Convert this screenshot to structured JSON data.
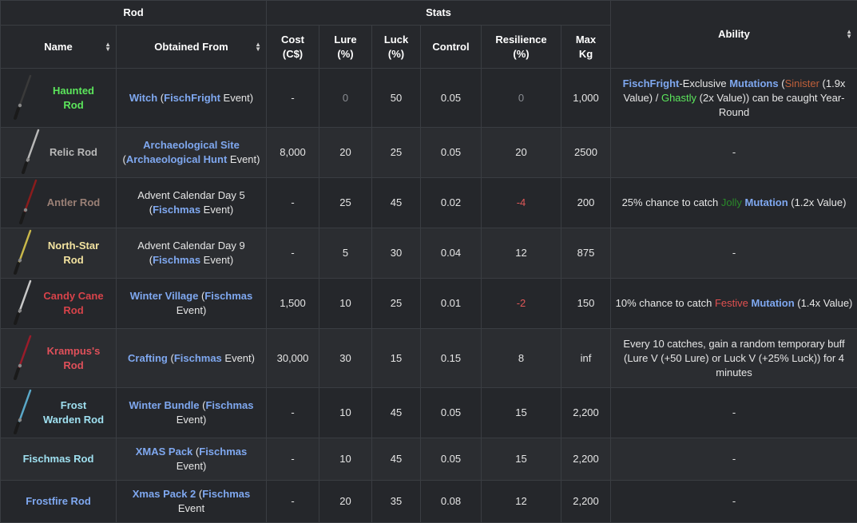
{
  "header": {
    "group_rod": "Rod",
    "group_stats": "Stats",
    "columns": {
      "name": "Name",
      "obtained": "Obtained From",
      "cost": "Cost (C$)",
      "lure": "Lure (%)",
      "luck": "Luck (%)",
      "control": "Control",
      "resilience": "Resilience (%)",
      "maxkg": "Max Kg",
      "ability": "Ability"
    }
  },
  "rows": [
    {
      "name": "Haunted Rod",
      "name_color": "#5ce65c",
      "icon": "haunted-rod-icon",
      "icon_color": "#3a3a3a",
      "obtained": [
        {
          "t": "Witch",
          "c": "link"
        },
        {
          "t": " (",
          "c": "plain"
        },
        {
          "t": "FischFright",
          "c": "link"
        },
        {
          "t": " Event)",
          "c": "plain"
        }
      ],
      "cost": "-",
      "lure": "0",
      "lure_style": "muted",
      "luck": "50",
      "control": "0.05",
      "resilience": "0",
      "res_style": "muted",
      "maxkg": "1,000",
      "ability": [
        {
          "t": "FischFright",
          "c": "link"
        },
        {
          "t": "-Exclusive ",
          "c": "plain"
        },
        {
          "t": "Mutations",
          "c": "link"
        },
        {
          "t": " (",
          "c": "plain"
        },
        {
          "t": "Sinister",
          "c": "#c0603a"
        },
        {
          "t": " (1.9x Value) / ",
          "c": "plain"
        },
        {
          "t": "Ghastly",
          "c": "#5ce65c"
        },
        {
          "t": " (2x Value)) can be caught Year-Round",
          "c": "plain"
        }
      ]
    },
    {
      "name": "Relic Rod",
      "name_color": "#b8b8b8",
      "icon": "relic-rod-icon",
      "icon_color": "#b8b8b8",
      "obtained": [
        {
          "t": "Archaeological Site",
          "c": "link"
        },
        {
          "t": " (",
          "c": "plain"
        },
        {
          "t": "Archaeological Hunt",
          "c": "link"
        },
        {
          "t": " Event)",
          "c": "plain"
        }
      ],
      "cost": "8,000",
      "lure": "20",
      "lure_style": "plain",
      "luck": "25",
      "control": "0.05",
      "resilience": "20",
      "res_style": "plain",
      "maxkg": "2500",
      "ability": [
        {
          "t": "-",
          "c": "plain"
        }
      ]
    },
    {
      "name": "Antler Rod",
      "name_color": "#9a8076",
      "icon": "antler-rod-icon",
      "icon_color": "#8a1c1c",
      "obtained": [
        {
          "t": "Advent Calendar Day 5 (",
          "c": "plain"
        },
        {
          "t": "Fischmas",
          "c": "link"
        },
        {
          "t": " Event)",
          "c": "plain"
        }
      ],
      "cost": "-",
      "lure": "25",
      "lure_style": "plain",
      "luck": "45",
      "control": "0.02",
      "resilience": "-4",
      "res_style": "neg",
      "maxkg": "200",
      "ability": [
        {
          "t": "25% chance to catch ",
          "c": "plain"
        },
        {
          "t": "Jolly",
          "c": "#2a8a2a"
        },
        {
          "t": " ",
          "c": "plain"
        },
        {
          "t": "Mutation",
          "c": "link"
        },
        {
          "t": " (1.2x Value)",
          "c": "plain"
        }
      ]
    },
    {
      "name": "North-Star Rod",
      "name_color": "#f3e3a0",
      "icon": "north-star-rod-icon",
      "icon_color": "#c9b84a",
      "obtained": [
        {
          "t": "Advent Calendar Day 9 (",
          "c": "plain"
        },
        {
          "t": "Fischmas",
          "c": "link"
        },
        {
          "t": " Event)",
          "c": "plain"
        }
      ],
      "cost": "-",
      "lure": "5",
      "lure_style": "plain",
      "luck": "30",
      "control": "0.04",
      "resilience": "12",
      "res_style": "plain",
      "maxkg": "875",
      "ability": [
        {
          "t": "-",
          "c": "plain"
        }
      ]
    },
    {
      "name": "Candy Cane Rod",
      "name_color": "#d8434a",
      "icon": "candy-cane-rod-icon",
      "icon_color": "#c8c8c8",
      "obtained": [
        {
          "t": "Winter Village",
          "c": "link"
        },
        {
          "t": " (",
          "c": "plain"
        },
        {
          "t": "Fischmas",
          "c": "link"
        },
        {
          "t": " Event)",
          "c": "plain"
        }
      ],
      "cost": "1,500",
      "lure": "10",
      "lure_style": "plain",
      "luck": "25",
      "control": "0.01",
      "resilience": "-2",
      "res_style": "neg",
      "maxkg": "150",
      "ability": [
        {
          "t": "10% chance to catch ",
          "c": "plain"
        },
        {
          "t": "Festive",
          "c": "#e05050"
        },
        {
          "t": " ",
          "c": "plain"
        },
        {
          "t": "Mutation",
          "c": "link"
        },
        {
          "t": " (1.4x Value)",
          "c": "plain"
        }
      ]
    },
    {
      "name": "Krampus's Rod",
      "name_color": "#e0505a",
      "icon": "krampus-rod-icon",
      "icon_color": "#9a1c2a",
      "obtained": [
        {
          "t": "Crafting",
          "c": "link"
        },
        {
          "t": " (",
          "c": "plain"
        },
        {
          "t": "Fischmas",
          "c": "link"
        },
        {
          "t": " Event)",
          "c": "plain"
        }
      ],
      "cost": "30,000",
      "lure": "30",
      "lure_style": "plain",
      "luck": "15",
      "control": "0.15",
      "resilience": "8",
      "res_style": "plain",
      "maxkg": "inf",
      "ability": [
        {
          "t": "Every 10 catches, gain a random temporary buff (Lure V (+50 Lure) or Luck V (+25% Luck)) for 4 minutes",
          "c": "plain"
        }
      ]
    },
    {
      "name": "Frost Warden Rod",
      "name_color": "#9fe0f0",
      "icon": "frost-warden-rod-icon",
      "icon_color": "#5aa8c8",
      "obtained": [
        {
          "t": "Winter Bundle",
          "c": "link"
        },
        {
          "t": " (",
          "c": "plain"
        },
        {
          "t": "Fischmas",
          "c": "link"
        },
        {
          "t": " Event)",
          "c": "plain"
        }
      ],
      "cost": "-",
      "lure": "10",
      "lure_style": "plain",
      "luck": "45",
      "control": "0.05",
      "resilience": "15",
      "res_style": "plain",
      "maxkg": "2,200",
      "ability": [
        {
          "t": "-",
          "c": "plain"
        }
      ]
    },
    {
      "name": "Fischmas Rod",
      "name_color": "#9fe0f0",
      "icon": "",
      "icon_color": "",
      "obtained": [
        {
          "t": "XMAS Pack",
          "c": "link"
        },
        {
          "t": " (",
          "c": "plain"
        },
        {
          "t": "Fischmas",
          "c": "link"
        },
        {
          "t": " Event)",
          "c": "plain"
        }
      ],
      "cost": "-",
      "lure": "10",
      "lure_style": "plain",
      "luck": "45",
      "control": "0.05",
      "resilience": "15",
      "res_style": "plain",
      "maxkg": "2,200",
      "ability": [
        {
          "t": "-",
          "c": "plain"
        }
      ]
    },
    {
      "name": "Frostfire Rod",
      "name_color": "#7fa8f0",
      "icon": "",
      "icon_color": "",
      "obtained": [
        {
          "t": "Xmas Pack 2",
          "c": "link"
        },
        {
          "t": " (",
          "c": "plain"
        },
        {
          "t": "Fischmas",
          "c": "link"
        },
        {
          "t": " Event",
          "c": "plain"
        }
      ],
      "cost": "-",
      "lure": "20",
      "lure_style": "plain",
      "luck": "35",
      "control": "0.08",
      "resilience": "12",
      "res_style": "plain",
      "maxkg": "2,200",
      "ability": [
        {
          "t": "-",
          "c": "plain"
        }
      ]
    }
  ]
}
